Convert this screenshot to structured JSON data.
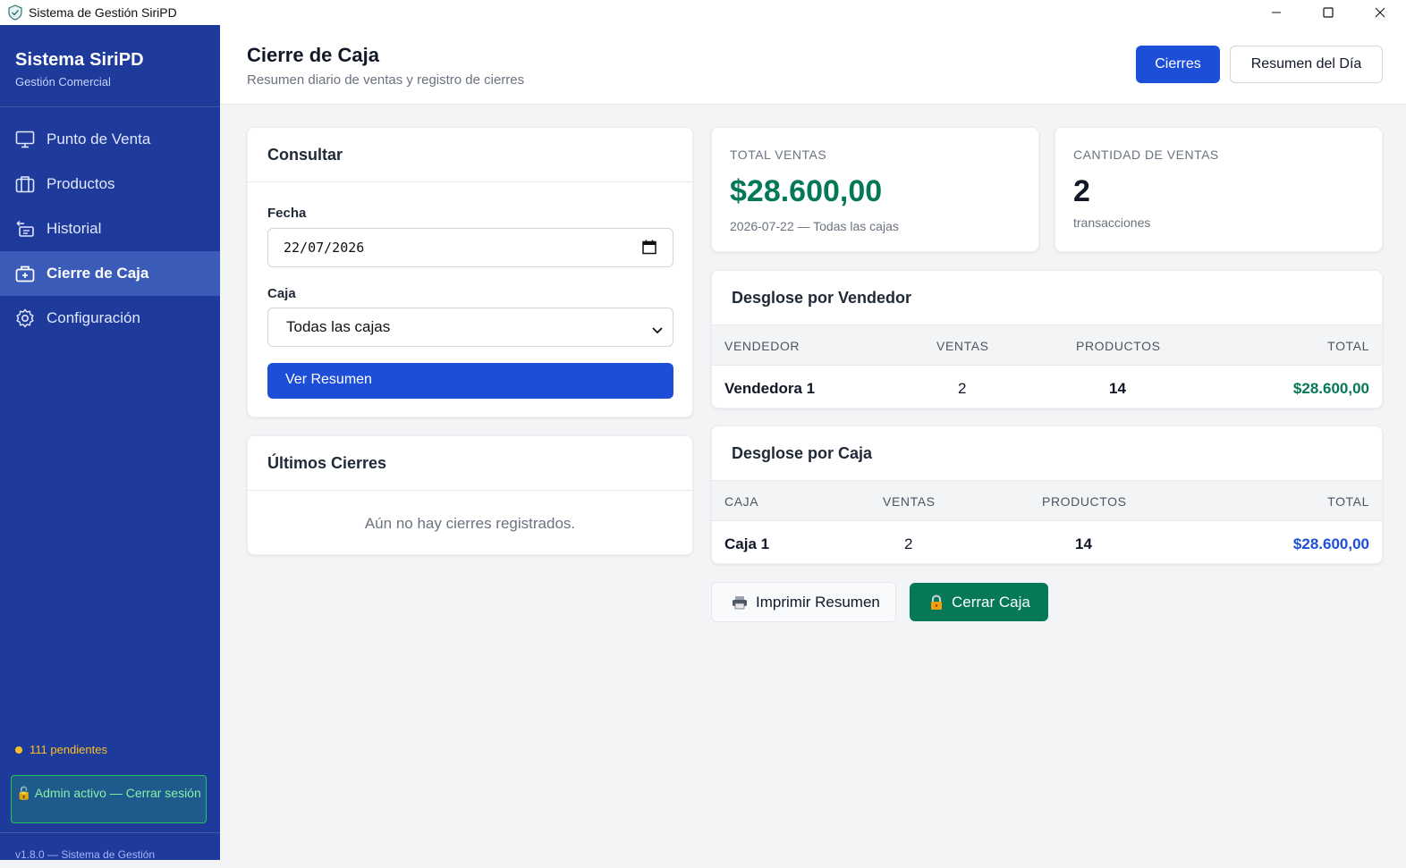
{
  "window": {
    "title": "Sistema de Gestión SiriPD"
  },
  "sidebar": {
    "brand_name": "Sistema SiriPD",
    "brand_sub": "Gestión Comercial",
    "items": [
      {
        "label": "Punto de Venta",
        "icon": "monitor-icon"
      },
      {
        "label": "Productos",
        "icon": "box-icon"
      },
      {
        "label": "Historial",
        "icon": "history-icon"
      },
      {
        "label": "Cierre de Caja",
        "icon": "cash-register-icon",
        "active": true
      },
      {
        "label": "Configuración",
        "icon": "gear-icon"
      }
    ],
    "pending": "111 pendientes",
    "admin_button": "Admin activo — Cerrar sesión",
    "footer": "v1.8.0 — Sistema de Gestión"
  },
  "header": {
    "title": "Cierre de Caja",
    "subtitle": "Resumen diario de ventas y registro de cierres",
    "btn_cierres": "Cierres",
    "btn_resumen": "Resumen del Día"
  },
  "consultar": {
    "title": "Consultar",
    "fecha_label": "Fecha",
    "fecha_value": "22/07/2026",
    "caja_label": "Caja",
    "caja_value": "Todas las cajas",
    "ver_button": "Ver Resumen"
  },
  "ultimos": {
    "title": "Últimos Cierres",
    "empty": "Aún no hay cierres registrados."
  },
  "stats": {
    "total_label": "TOTAL VENTAS",
    "total_value": "$28.600,00",
    "total_note": "2026-07-22 — Todas las cajas",
    "count_label": "CANTIDAD DE VENTAS",
    "count_value": "2",
    "count_note": "transacciones"
  },
  "por_vendedor": {
    "title": "Desglose por Vendedor",
    "columns": [
      "VENDEDOR",
      "VENTAS",
      "PRODUCTOS",
      "TOTAL"
    ],
    "rows": [
      {
        "name": "Vendedora 1",
        "ventas": "2",
        "productos": "14",
        "total": "$28.600,00"
      }
    ]
  },
  "por_caja": {
    "title": "Desglose por Caja",
    "columns": [
      "CAJA",
      "VENTAS",
      "PRODUCTOS",
      "TOTAL"
    ],
    "rows": [
      {
        "name": "Caja 1",
        "ventas": "2",
        "productos": "14",
        "total": "$28.600,00"
      }
    ]
  },
  "actions": {
    "print": "Imprimir Resumen",
    "close": "Cerrar Caja"
  },
  "colors": {
    "sidebar": "#1e3a9a",
    "primary": "#1d4ed8",
    "success": "#047857",
    "warning": "#fbbf24"
  }
}
